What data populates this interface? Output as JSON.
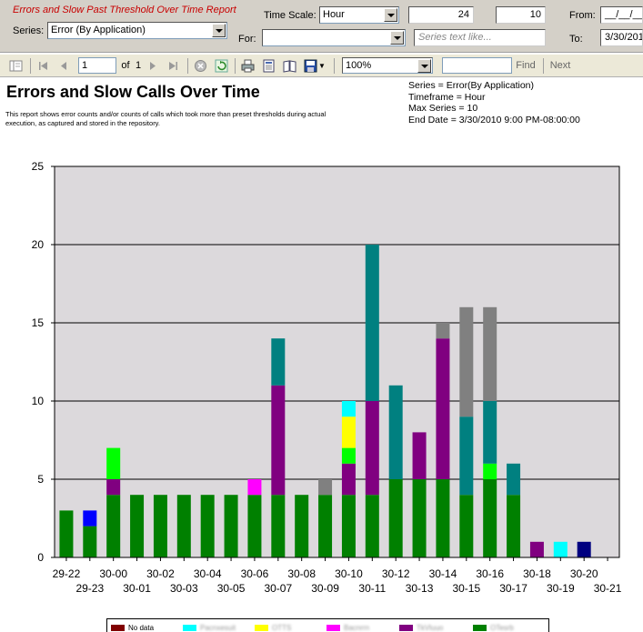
{
  "filter_bar": {
    "report_title": "Errors and Slow Past Threshold Over Time Report",
    "series_label": "Series:",
    "series_value": "Error (By Application)",
    "time_scale_label": "Time Scale:",
    "time_scale_value": "Hour",
    "count_value": "24",
    "max_series_value": "10",
    "from_label": "From:",
    "from_value": "__/__/__",
    "for_label": "For:",
    "for_value": "",
    "series_text_placeholder": "Series text like...",
    "to_label": "To:",
    "to_value": "3/30/201"
  },
  "toolbar": {
    "page_current": "1",
    "page_of": "of",
    "page_total": "1",
    "zoom_value": "100%",
    "find_label": "Find",
    "next_label": "Next",
    "search_value": ""
  },
  "report": {
    "title": "Errors and Slow Calls Over Time",
    "description": "This report shows error counts and/or counts of calls which took more than preset thresholds during actual execution, as captured and stored in the repository.",
    "meta": {
      "series": "Series = Error(By Application)",
      "timeframe": "Timeframe = Hour",
      "max_series": "Max Series = 10",
      "end_date": "End Date = 3/30/2010 9:00 PM-08:00:00"
    }
  },
  "colors": {
    "green": "#008000",
    "purple": "#800080",
    "teal": "#008080",
    "gray": "#808080",
    "lime": "#00ff00",
    "yellow": "#ffff00",
    "magenta": "#ff00ff",
    "cyan": "#00ffff",
    "blue": "#0000ff",
    "navy": "#000080",
    "dark_red": "#800000",
    "plot_bg": "#dcd9dc"
  },
  "chart_data": {
    "type": "bar",
    "stacked": true,
    "ylim": [
      0,
      25
    ],
    "yticks": [
      0,
      5,
      10,
      15,
      20,
      25
    ],
    "grid": true,
    "categories": [
      "29-22",
      "29-23",
      "30-00",
      "30-01",
      "30-02",
      "30-03",
      "30-04",
      "30-05",
      "30-06",
      "30-07",
      "30-08",
      "30-09",
      "30-10",
      "30-11",
      "30-12",
      "30-13",
      "30-14",
      "30-15",
      "30-16",
      "30-17",
      "30-18",
      "30-19",
      "30-20",
      "30-21"
    ],
    "stacks": [
      [
        {
          "color": "green",
          "value": 3
        }
      ],
      [
        {
          "color": "green",
          "value": 2
        },
        {
          "color": "blue",
          "value": 1
        }
      ],
      [
        {
          "color": "green",
          "value": 4
        },
        {
          "color": "purple",
          "value": 1
        },
        {
          "color": "lime",
          "value": 2
        }
      ],
      [
        {
          "color": "green",
          "value": 4
        }
      ],
      [
        {
          "color": "green",
          "value": 4
        }
      ],
      [
        {
          "color": "green",
          "value": 4
        }
      ],
      [
        {
          "color": "green",
          "value": 4
        }
      ],
      [
        {
          "color": "green",
          "value": 4
        }
      ],
      [
        {
          "color": "green",
          "value": 4
        },
        {
          "color": "magenta",
          "value": 1
        }
      ],
      [
        {
          "color": "green",
          "value": 4
        },
        {
          "color": "purple",
          "value": 7
        },
        {
          "color": "teal",
          "value": 3
        }
      ],
      [
        {
          "color": "green",
          "value": 4
        }
      ],
      [
        {
          "color": "green",
          "value": 4
        },
        {
          "color": "gray",
          "value": 1
        }
      ],
      [
        {
          "color": "green",
          "value": 4
        },
        {
          "color": "purple",
          "value": 2
        },
        {
          "color": "lime",
          "value": 1
        },
        {
          "color": "yellow",
          "value": 2
        },
        {
          "color": "cyan",
          "value": 1
        }
      ],
      [
        {
          "color": "green",
          "value": 4
        },
        {
          "color": "purple",
          "value": 6
        },
        {
          "color": "teal",
          "value": 10
        }
      ],
      [
        {
          "color": "green",
          "value": 5
        },
        {
          "color": "teal",
          "value": 6
        }
      ],
      [
        {
          "color": "green",
          "value": 5
        },
        {
          "color": "purple",
          "value": 3
        }
      ],
      [
        {
          "color": "green",
          "value": 5
        },
        {
          "color": "purple",
          "value": 9
        },
        {
          "color": "gray",
          "value": 1
        }
      ],
      [
        {
          "color": "green",
          "value": 4
        },
        {
          "color": "teal",
          "value": 5
        },
        {
          "color": "gray",
          "value": 7
        }
      ],
      [
        {
          "color": "green",
          "value": 5
        },
        {
          "color": "lime",
          "value": 1
        },
        {
          "color": "teal",
          "value": 4
        },
        {
          "color": "gray",
          "value": 6
        }
      ],
      [
        {
          "color": "green",
          "value": 4
        },
        {
          "color": "teal",
          "value": 2
        }
      ],
      [
        {
          "color": "purple",
          "value": 1
        }
      ],
      [
        {
          "color": "cyan",
          "value": 1
        }
      ],
      [
        {
          "color": "navy",
          "value": 1
        }
      ],
      []
    ],
    "legend": [
      {
        "label": "No data",
        "color": "dark_red",
        "obscured": false
      },
      {
        "label": "Pacnxesuit",
        "color": "cyan",
        "obscured": true
      },
      {
        "label": "OTTS",
        "color": "yellow",
        "obscured": true
      },
      {
        "label": "Bacnrrn",
        "color": "magenta",
        "obscured": true
      },
      {
        "label": "TkVluuo",
        "color": "purple",
        "obscured": true
      },
      {
        "label": "OTesrb",
        "color": "green",
        "obscured": true
      }
    ],
    "legend_position": "bottom"
  }
}
